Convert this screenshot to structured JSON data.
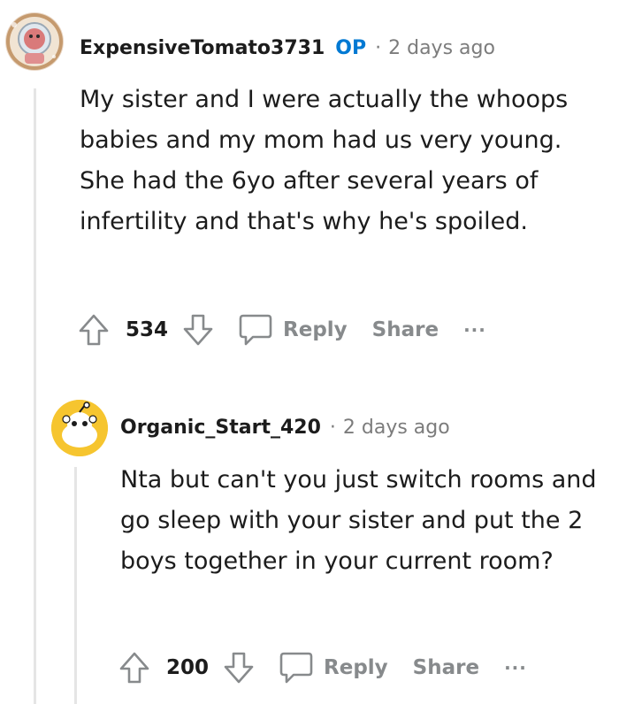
{
  "comments": [
    {
      "author": "ExpensiveTomato3731",
      "op_badge": "OP",
      "separator": "·",
      "time": "2 days ago",
      "body": "My sister and I were actually the whoops babies and my mom had us very young. She had the 6yo after several years of infertility and that's why he's spoiled.",
      "score": "534",
      "reply_label": "Reply",
      "share_label": "Share",
      "more_label": "···"
    },
    {
      "author": "Organic_Start_420",
      "separator": "·",
      "time": "2 days ago",
      "body": "Nta but can't you just switch rooms and go sleep with your sister and put the 2 boys together in your current room?",
      "score": "200",
      "reply_label": "Reply",
      "share_label": "Share",
      "more_label": "···"
    }
  ],
  "icons": {
    "upvote": "arrow-up-icon",
    "downvote": "arrow-down-icon",
    "reply": "speech-bubble-icon",
    "more": "ellipsis-icon"
  },
  "colors": {
    "op_badge": "#0079d3",
    "meta_text": "#7c7c7c",
    "action_text": "#878a8c",
    "thread_line": "#e5e5e5",
    "avatar2_bg": "#f6c52f"
  }
}
